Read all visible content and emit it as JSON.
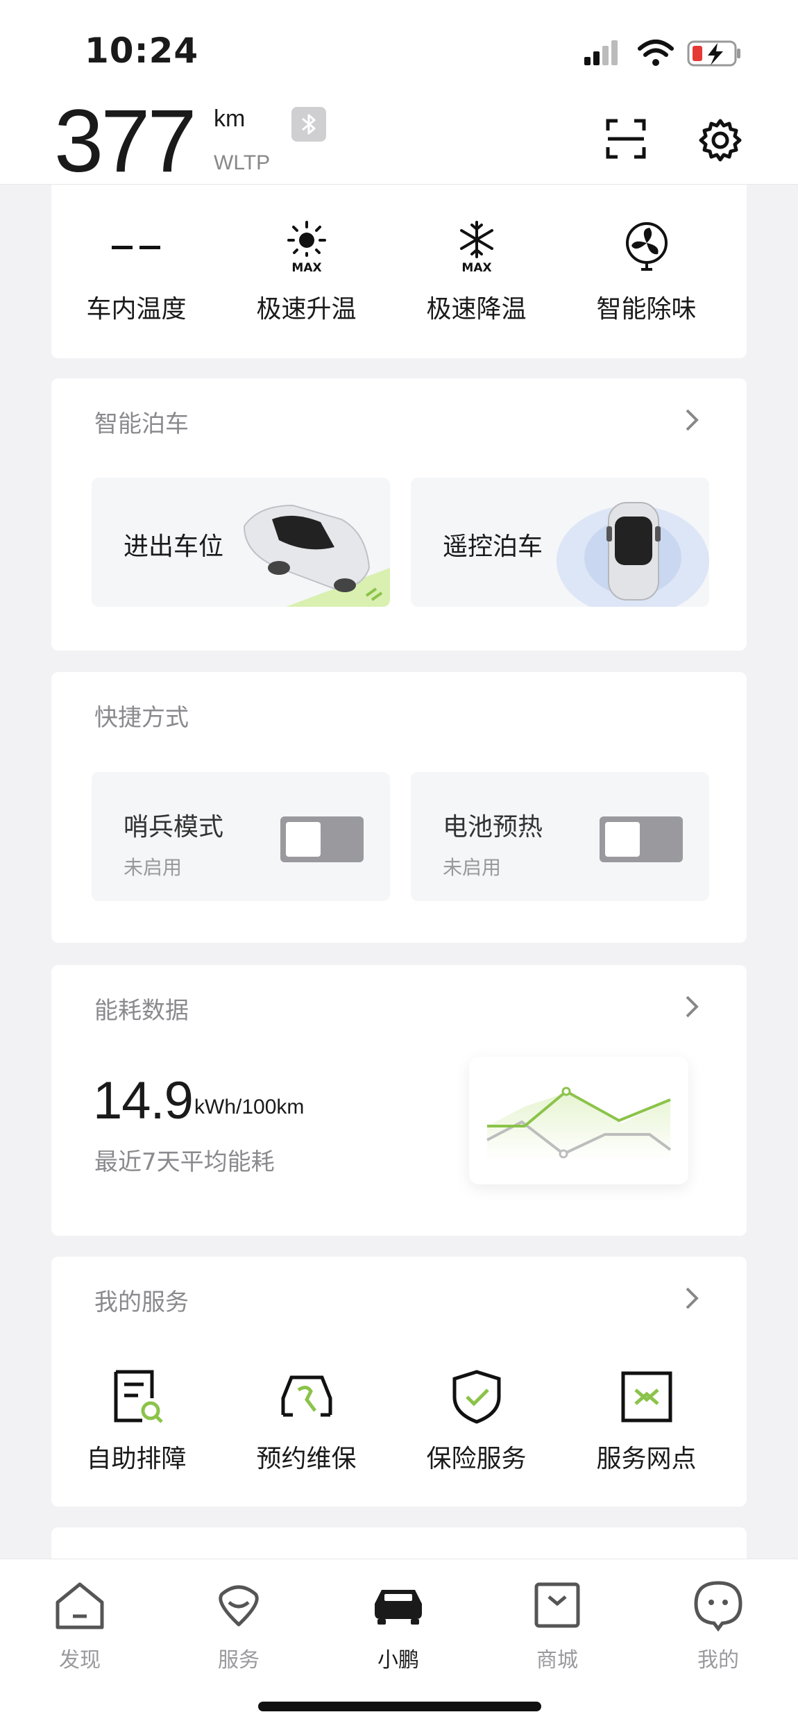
{
  "status_bar": {
    "time": "10:24"
  },
  "header": {
    "range_value": "377",
    "range_unit": "km",
    "range_standard": "WLTP"
  },
  "climate": {
    "items": [
      {
        "label": "车内温度",
        "value": "--",
        "icon": "temperature-dash"
      },
      {
        "label": "极速升温",
        "icon": "sun-max-icon",
        "badge": "MAX"
      },
      {
        "label": "极速降温",
        "icon": "snowflake-max-icon",
        "badge": "MAX"
      },
      {
        "label": "智能除味",
        "icon": "fan-icon"
      }
    ]
  },
  "parking": {
    "title": "智能泊车",
    "tiles": [
      {
        "label": "进出车位"
      },
      {
        "label": "遥控泊车"
      }
    ]
  },
  "shortcuts": {
    "title": "快捷方式",
    "items": [
      {
        "name": "哨兵模式",
        "state": "未启用",
        "enabled": false
      },
      {
        "name": "电池预热",
        "state": "未启用",
        "enabled": false
      }
    ]
  },
  "energy": {
    "title": "能耗数据",
    "value": "14.9",
    "unit": "kWh/100km",
    "subtitle": "最近7天平均能耗",
    "accent": "#8bc34a"
  },
  "services": {
    "title": "我的服务",
    "items": [
      {
        "label": "自助排障",
        "icon": "self-diagnose-icon"
      },
      {
        "label": "预约维保",
        "icon": "car-maintenance-icon"
      },
      {
        "label": "保险服务",
        "icon": "insurance-shield-icon"
      },
      {
        "label": "服务网点",
        "icon": "service-map-icon"
      }
    ]
  },
  "tabbar": {
    "items": [
      {
        "label": "发现",
        "active": false
      },
      {
        "label": "服务",
        "active": false
      },
      {
        "label": "小鹏",
        "active": true
      },
      {
        "label": "商城",
        "active": false
      },
      {
        "label": "我的",
        "active": false
      }
    ]
  }
}
